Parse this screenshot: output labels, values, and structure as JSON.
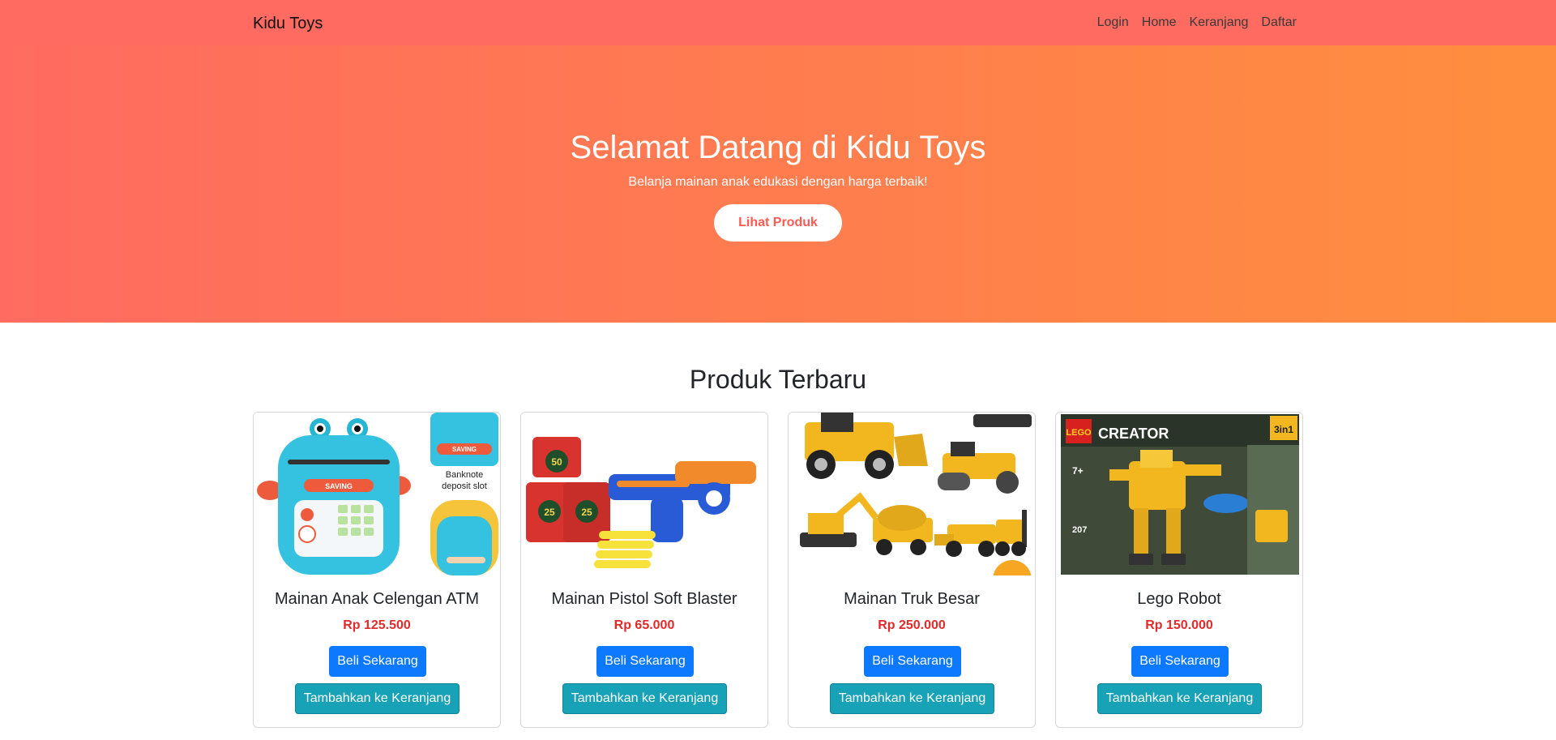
{
  "navbar": {
    "brand": "Kidu Toys",
    "links": [
      "Login",
      "Home",
      "Keranjang",
      "Daftar"
    ]
  },
  "hero": {
    "title": "Selamat Datang di Kidu Toys",
    "subtitle": "Belanja mainan anak edukasi dengan harga terbaik!",
    "button": "Lihat Produk"
  },
  "section": {
    "title": "Produk Terbaru"
  },
  "products": [
    {
      "name": "Mainan Anak Celengan ATM",
      "price": "Rp 125.500",
      "buy_label": "Beli Sekarang",
      "cart_label": "Tambahkan ke Keranjang",
      "image_text": [
        "SAVING",
        "SAVING",
        "Banknote",
        "deposit slot"
      ]
    },
    {
      "name": "Mainan Pistol Soft Blaster",
      "price": "Rp 65.000",
      "buy_label": "Beli Sekarang",
      "cart_label": "Tambahkan ke Keranjang",
      "image_text": [
        "50",
        "25",
        "25"
      ]
    },
    {
      "name": "Mainan Truk Besar",
      "price": "Rp 250.000",
      "buy_label": "Beli Sekarang",
      "cart_label": "Tambahkan ke Keranjang"
    },
    {
      "name": "Lego Robot",
      "price": "Rp 150.000",
      "buy_label": "Beli Sekarang",
      "cart_label": "Tambahkan ke Keranjang",
      "image_text": [
        "LEGO",
        "CREATOR",
        "3in1",
        "7+",
        "207"
      ]
    }
  ]
}
